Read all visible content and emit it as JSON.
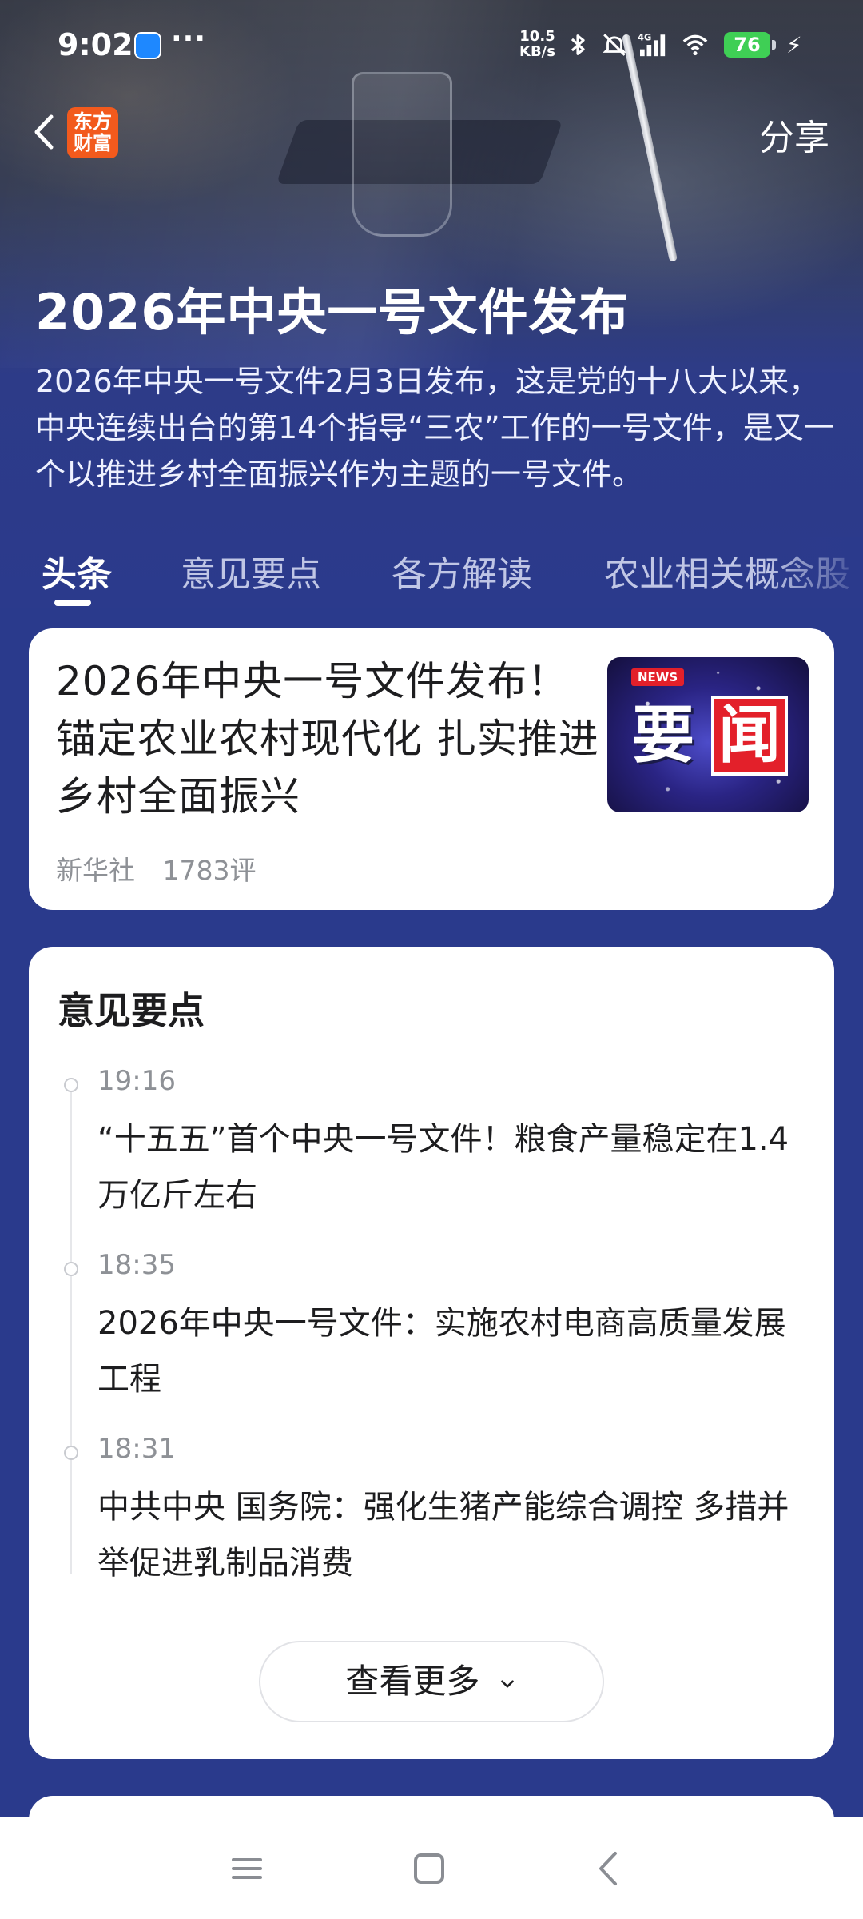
{
  "status_bar": {
    "time": "9:02",
    "more": "···",
    "net_speed_value": "10.5",
    "net_speed_unit": "KB/s",
    "signal_label": "4G",
    "battery": "76",
    "icons": [
      "bluetooth-icon",
      "mute-icon",
      "signal-icon",
      "wifi-icon",
      "battery-icon",
      "charging-icon"
    ]
  },
  "header": {
    "logo_line1": "东方",
    "logo_line2": "财富",
    "share_label": "分享"
  },
  "hero": {
    "title": "2026年中央一号文件发布",
    "description": "2026年中央一号文件2月3日发布，这是党的十八大以来，中央连续出台的第14个指导“三农”工作的一号文件，是又一个以推进乡村全面振兴作为主题的一号文件。"
  },
  "tabs": [
    {
      "label": "头条",
      "active": true
    },
    {
      "label": "意见要点",
      "active": false
    },
    {
      "label": "各方解读",
      "active": false
    },
    {
      "label": "农业相关概念股",
      "active": false
    }
  ],
  "headline": {
    "title": "2026年中央一号文件发布！锚定农业农村现代化 扎实推进乡村全面振兴",
    "source": "新华社",
    "comments": "1783评",
    "thumb_badge": "NEWS",
    "thumb_char1": "要",
    "thumb_char2": "闻"
  },
  "key_points": {
    "title": "意见要点",
    "items": [
      {
        "time": "19:16",
        "text": "“十五五”首个中央一号文件！粮食产量稳定在1.4万亿斤左右"
      },
      {
        "time": "18:35",
        "text": "2026年中央一号文件：实施农村电商高质量发展工程"
      },
      {
        "time": "18:31",
        "text": "中共中央 国务院：强化生猪产能综合调控 多措并举促进乳制品消费"
      }
    ],
    "more_label": "查看更多"
  },
  "colors": {
    "hero_blue": "#2b3a8c",
    "battery_green": "#3fcf55",
    "logo_orange": "#f25a1d",
    "badge_red": "#e3202a"
  }
}
